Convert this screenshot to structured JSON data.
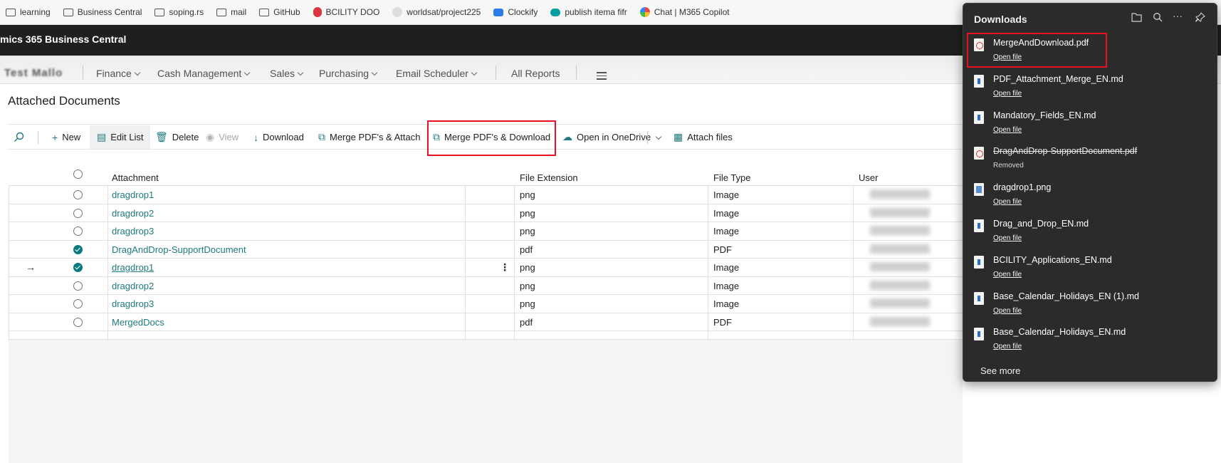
{
  "bookmarks": [
    {
      "label": "learning",
      "icon": "folder-icon"
    },
    {
      "label": "Business Central",
      "icon": "folder-icon"
    },
    {
      "label": "soping.rs",
      "icon": "folder-icon"
    },
    {
      "label": "mail",
      "icon": "folder-icon"
    },
    {
      "label": "GitHub",
      "icon": "folder-icon"
    },
    {
      "label": "BCILITY DOO",
      "icon": "bcility-icon"
    },
    {
      "label": "worldsat/project225",
      "icon": "site-icon"
    },
    {
      "label": "Clockify",
      "icon": "clockify-icon"
    },
    {
      "label": "publish itema fifr",
      "icon": "publish-icon"
    },
    {
      "label": "Chat | M365 Copilot",
      "icon": "copilot-icon"
    }
  ],
  "app": {
    "title": "mics 365 Business Central"
  },
  "nav": {
    "company": "Test Mallo",
    "items": [
      "Finance",
      "Cash Management",
      "Sales",
      "Purchasing",
      "Email Scheduler"
    ],
    "all_reports": "All Reports"
  },
  "page": {
    "title": "Attached Documents"
  },
  "actions": {
    "new": "New",
    "edit_list": "Edit List",
    "delete": "Delete",
    "view": "View",
    "download": "Download",
    "merge_attach": "Merge PDF's & Attach",
    "merge_download": "Merge PDF's & Download",
    "open_onedrive": "Open in OneDrive",
    "attach_files": "Attach files"
  },
  "table": {
    "headers": {
      "attachment": "Attachment",
      "file_extension": "File Extension",
      "file_type": "File Type",
      "user": "User"
    },
    "rows": [
      {
        "attachment": "dragdrop1",
        "ext": "png",
        "type": "Image",
        "checked": false,
        "current": false
      },
      {
        "attachment": "dragdrop2",
        "ext": "png",
        "type": "Image",
        "checked": false,
        "current": false
      },
      {
        "attachment": "dragdrop3",
        "ext": "png",
        "type": "Image",
        "checked": false,
        "current": false
      },
      {
        "attachment": "DragAndDrop-SupportDocument",
        "ext": "pdf",
        "type": "PDF",
        "checked": true,
        "current": false
      },
      {
        "attachment": "dragdrop1",
        "ext": "png",
        "type": "Image",
        "checked": true,
        "current": true
      },
      {
        "attachment": "dragdrop2",
        "ext": "png",
        "type": "Image",
        "checked": false,
        "current": false
      },
      {
        "attachment": "dragdrop3",
        "ext": "png",
        "type": "Image",
        "checked": false,
        "current": false
      },
      {
        "attachment": "MergedDocs",
        "ext": "pdf",
        "type": "PDF",
        "checked": false,
        "current": false
      }
    ]
  },
  "downloads": {
    "title": "Downloads",
    "items": [
      {
        "name": "MergeAndDownload.pdf",
        "status": "Open file",
        "kind": "pdf",
        "removed": false
      },
      {
        "name": "PDF_Attachment_Merge_EN.md",
        "status": "Open file",
        "kind": "md",
        "removed": false
      },
      {
        "name": "Mandatory_Fields_EN.md",
        "status": "Open file",
        "kind": "md",
        "removed": false
      },
      {
        "name": "DragAndDrop-SupportDocument.pdf",
        "status": "Removed",
        "kind": "pdf",
        "removed": true
      },
      {
        "name": "dragdrop1.png",
        "status": "Open file",
        "kind": "png",
        "removed": false
      },
      {
        "name": "Drag_and_Drop_EN.md",
        "status": "Open file",
        "kind": "md",
        "removed": false
      },
      {
        "name": "BCILITY_Applications_EN.md",
        "status": "Open file",
        "kind": "md",
        "removed": false
      },
      {
        "name": "Base_Calendar_Holidays_EN (1).md",
        "status": "Open file",
        "kind": "md",
        "removed": false
      },
      {
        "name": "Base_Calendar_Holidays_EN.md",
        "status": "Open file",
        "kind": "md",
        "removed": false
      }
    ],
    "see_more": "See more"
  },
  "colors": {
    "accent": "#1d7a7e",
    "highlight": "#e81123",
    "panel": "#2b2b2b",
    "appbar": "#1f1f1f"
  }
}
